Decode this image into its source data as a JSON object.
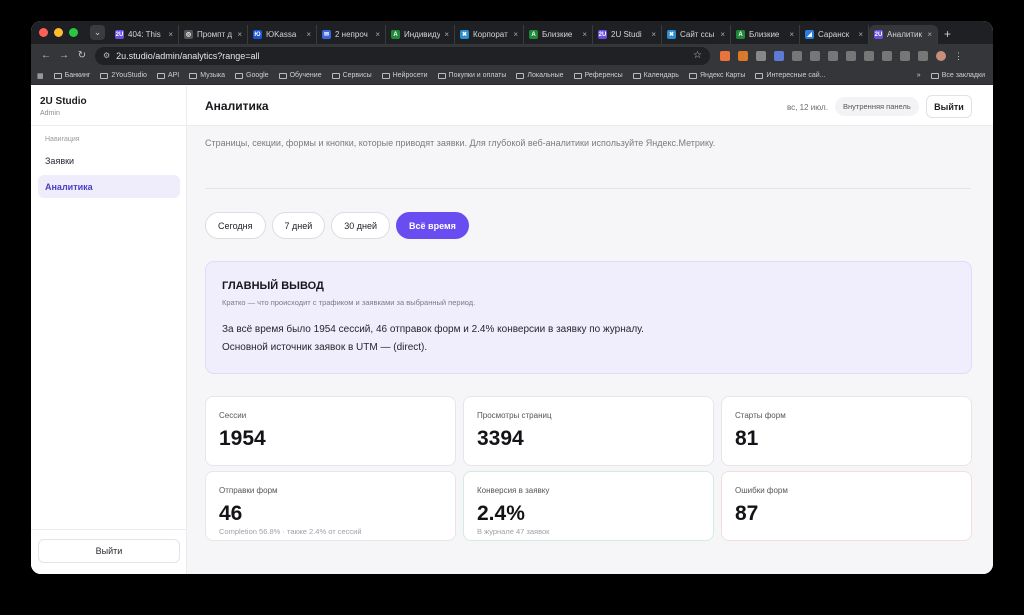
{
  "browser": {
    "tabs": [
      {
        "label": "404: This",
        "fav": "2U",
        "color": "#6b4fe0"
      },
      {
        "label": "Промпт д",
        "fav": "◎",
        "color": "#555"
      },
      {
        "label": "ЮKassa",
        "fav": "Ю",
        "color": "#1a56d8"
      },
      {
        "label": "2 непроч",
        "fav": "✉",
        "color": "#3a66e0"
      },
      {
        "label": "Индивиду",
        "fav": "A",
        "color": "#1f8a3a"
      },
      {
        "label": "Корпорат",
        "fav": "✖",
        "color": "#2b8fd6"
      },
      {
        "label": "Близкие",
        "fav": "A",
        "color": "#1f8a3a"
      },
      {
        "label": "2U Studi",
        "fav": "2U",
        "color": "#6b4fe0"
      },
      {
        "label": "Сайт ссы",
        "fav": "✖",
        "color": "#2b8fd6"
      },
      {
        "label": "Близкие",
        "fav": "A",
        "color": "#1f8a3a"
      },
      {
        "label": "Саранск",
        "fav": "◢",
        "color": "#2b7de0"
      },
      {
        "label": "Аналитик",
        "fav": "2U",
        "color": "#6b4fe0"
      }
    ],
    "url": "2u.studio/admin/analytics?range=all",
    "bookmarks": [
      "Банкинг",
      "2YouStudio",
      "API",
      "Музыка",
      "Google",
      "Обучение",
      "Сервисы",
      "Нейросети",
      "Покупки и оплаты",
      "Локальные",
      "Референсы",
      "Календарь",
      "Яндекс Карты",
      "Интересные сай..."
    ],
    "bookmarks_more": "»",
    "all_bookmarks": "Все закладки"
  },
  "sidebar": {
    "brand": "2U Studio",
    "role": "Admin",
    "section": "Навигация",
    "items": [
      {
        "label": "Заявки"
      },
      {
        "label": "Аналитика"
      }
    ],
    "logout": "Выйти"
  },
  "header": {
    "title": "Аналитика",
    "date": "вс, 12 июл.",
    "panel_label": "Внутренняя панель",
    "logout": "Выйти"
  },
  "intro": "Страницы, секции, формы и кнопки, которые приводят заявки. Для глубокой веб-аналитики используйте Яндекс.Метрику.",
  "filters": [
    {
      "label": "Сегодня",
      "active": false
    },
    {
      "label": "7 дней",
      "active": false
    },
    {
      "label": "30 дней",
      "active": false
    },
    {
      "label": "Всё время",
      "active": true
    }
  ],
  "summary": {
    "title": "ГЛАВНЫЙ ВЫВОД",
    "subtitle": "Кратко — что происходит с трафиком и заявками за выбранный период.",
    "line1": "За всё время было 1954 сессий, 46 отправок форм и 2.4% конверсии в заявку по журналу.",
    "line2": "Основной источник заявок в UTM — (direct)."
  },
  "metrics": [
    {
      "label": "Сессии",
      "value": "1954",
      "hint": ""
    },
    {
      "label": "Просмотры страниц",
      "value": "3394",
      "hint": ""
    },
    {
      "label": "Старты форм",
      "value": "81",
      "hint": ""
    },
    {
      "label": "Отправки форм",
      "value": "46",
      "hint": "Completion 56.8% · также 2.4% от сессий"
    },
    {
      "label": "Конверсия в заявку",
      "value": "2.4%",
      "hint": "В журнале 47 заявок"
    },
    {
      "label": "Ошибки форм",
      "value": "87",
      "hint": ""
    }
  ]
}
